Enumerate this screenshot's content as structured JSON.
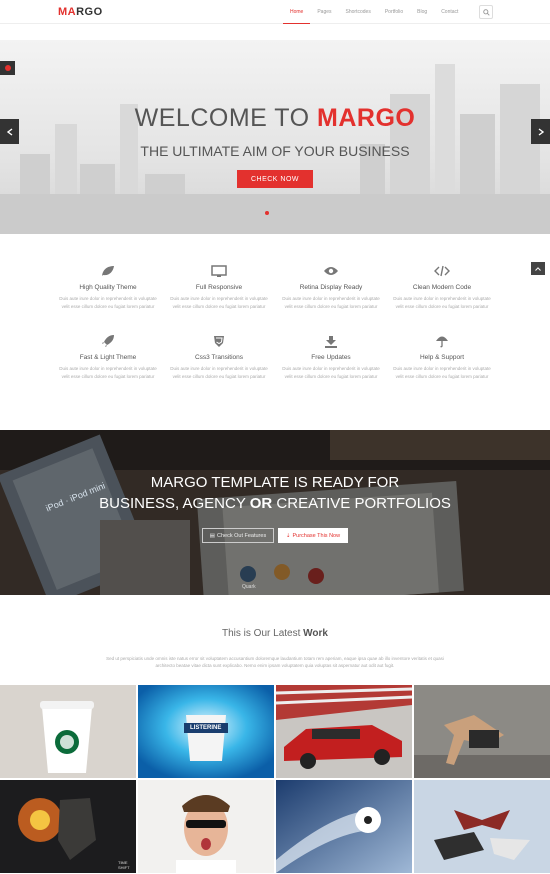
{
  "header": {
    "logo": {
      "prefix": "MA",
      "suffix": "RGO"
    },
    "nav": [
      {
        "label": "Home",
        "active": true
      },
      {
        "label": "Pages",
        "active": false
      },
      {
        "label": "Shortcodes",
        "active": false
      },
      {
        "label": "Portfolio",
        "active": false
      },
      {
        "label": "Blog",
        "active": false
      },
      {
        "label": "Contact",
        "active": false
      }
    ],
    "search_icon": "search-icon"
  },
  "hero": {
    "title_plain": "WELCOME TO",
    "title_accent": "MARGO",
    "subtitle": "THE ULTIMATE AIM OF YOUR BUSINESS",
    "cta": "CHECK NOW"
  },
  "features": [
    {
      "title": "High Quality Theme",
      "icon": "leaf-icon",
      "text": "Duis aute irure dolor in reprehenderit in voluptate velit esse cillum dolore eu fugiat lorem pariatur"
    },
    {
      "title": "Full Responsive",
      "icon": "desktop-icon",
      "text": "Duis aute irure dolor in reprehenderit in voluptate velit esse cillum dolore eu fugiat lorem pariatur"
    },
    {
      "title": "Retina Display Ready",
      "icon": "eye-icon",
      "text": "Duis aute irure dolor in reprehenderit in voluptate velit esse cillum dolore eu fugiat lorem pariatur"
    },
    {
      "title": "Clean Modern Code",
      "icon": "code-icon",
      "text": "Duis aute irure dolor in reprehenderit in voluptate velit esse cillum dolore eu fugiat lorem pariatur"
    },
    {
      "title": "Fast & Light Theme",
      "icon": "rocket-icon",
      "text": "Duis aute irure dolor in reprehenderit in voluptate velit esse cillum dolore eu fugiat lorem pariatur"
    },
    {
      "title": "Css3 Transitions",
      "icon": "css3-icon",
      "text": "Duis aute irure dolor in reprehenderit in voluptate velit esse cillum dolore eu fugiat lorem pariatur"
    },
    {
      "title": "Free Updates",
      "icon": "download-icon",
      "text": "Duis aute irure dolor in reprehenderit in voluptate velit esse cillum dolore eu fugiat lorem pariatur"
    },
    {
      "title": "Help & Support",
      "icon": "umbrella-icon",
      "text": "Duis aute irure dolor in reprehenderit in voluptate velit esse cillum dolore eu fugiat lorem pariatur"
    }
  ],
  "promo": {
    "line1": "MARGO TEMPLATE IS READY FOR",
    "line2_a": "BUSINESS, AGENCY",
    "line2_bold": "OR",
    "line2_b": "CREATIVE PORTFOLIOS",
    "btn_features": "Check Out Features",
    "btn_purchase": "Purchase This Now",
    "photo_labels": {
      "ipod": "iPod · iPod mini",
      "quark": "Quark"
    }
  },
  "work": {
    "title_plain": "This is Our Latest",
    "title_bold": "Work",
    "text": "Sed ut perspiciatis unde omnis iste natus error sit voluptatem accusantium doloremque laudantium totam rem aperiam, eaque ipsa quae ab illo inventore veritatis et quasi architecto beatae vitae dicta sunt explicabo. Nemo enim ipsam voluptatem quia voluptas sit aspernatur aut odit aut fugit.",
    "tiles": [
      {
        "name": "coffee-cup",
        "caption": "STARBUCKS COFFEE"
      },
      {
        "name": "listerine",
        "caption": "LISTERINE"
      },
      {
        "name": "red-car",
        "caption": ""
      },
      {
        "name": "breakdancer",
        "caption": ""
      },
      {
        "name": "explosion-portrait",
        "caption": "TIME SHIFT"
      },
      {
        "name": "guy-sunglasses",
        "caption": ""
      },
      {
        "name": "soccer-ball",
        "caption": ""
      },
      {
        "name": "skydivers",
        "caption": ""
      }
    ]
  },
  "colors": {
    "accent": "#e3312e",
    "dark": "#333333"
  }
}
